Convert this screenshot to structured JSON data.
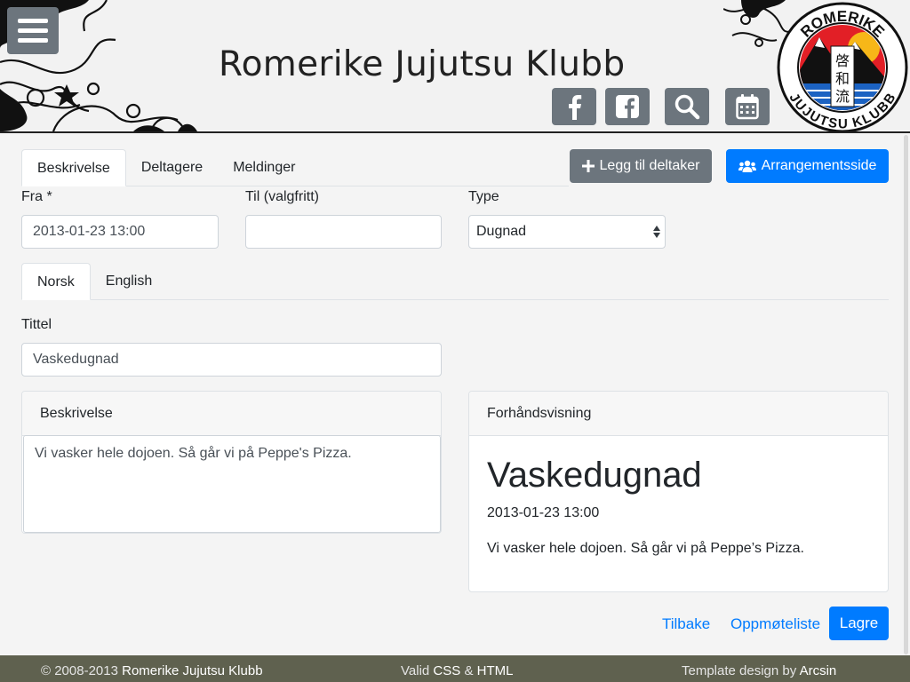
{
  "header": {
    "title": "Romerike Jujutsu Klubb",
    "logo_text_top": "ROMERIKE",
    "logo_text_bottom": "JUJUTSU KLUBB",
    "logo_kanji": [
      "啓",
      "和",
      "流"
    ]
  },
  "tabs": [
    "Beskrivelse",
    "Deltagere",
    "Meldinger"
  ],
  "actions": {
    "add_participant": "Legg til deltaker",
    "event_page": "Arrangementsside"
  },
  "form": {
    "from_label": "Fra *",
    "from_value": "2013-01-23 13:00",
    "to_label": "Til (valgfritt)",
    "to_value": "",
    "type_label": "Type",
    "type_value": "Dugnad"
  },
  "lang_tabs": [
    "Norsk",
    "English"
  ],
  "title_field": {
    "label": "Tittel",
    "value": "Vaskedugnad"
  },
  "description": {
    "header": "Beskrivelse",
    "value": "Vi vasker hele dojoen. Så går vi på Peppe's Pizza."
  },
  "preview": {
    "header": "Forhåndsvisning",
    "title": "Vaskedugnad",
    "date": "2013-01-23 13:00",
    "body": "Vi vasker hele dojoen. Så går vi på Peppe’s Pizza."
  },
  "bottom_actions": {
    "back": "Tilbake",
    "attendance": "Oppmøteliste",
    "save": "Lagre"
  },
  "footer": {
    "copyright_prefix": "© 2008-2013",
    "copyright_name": "Romerike Jujutsu Klubb",
    "valid_prefix": "Valid",
    "valid_css": "CSS",
    "valid_amp": "&",
    "valid_html": "HTML",
    "design_prefix": "Template design by",
    "design_name": "Arcsin"
  },
  "colors": {
    "primary": "#007bff",
    "secondary": "#6c757d",
    "footer": "#5f614f"
  }
}
